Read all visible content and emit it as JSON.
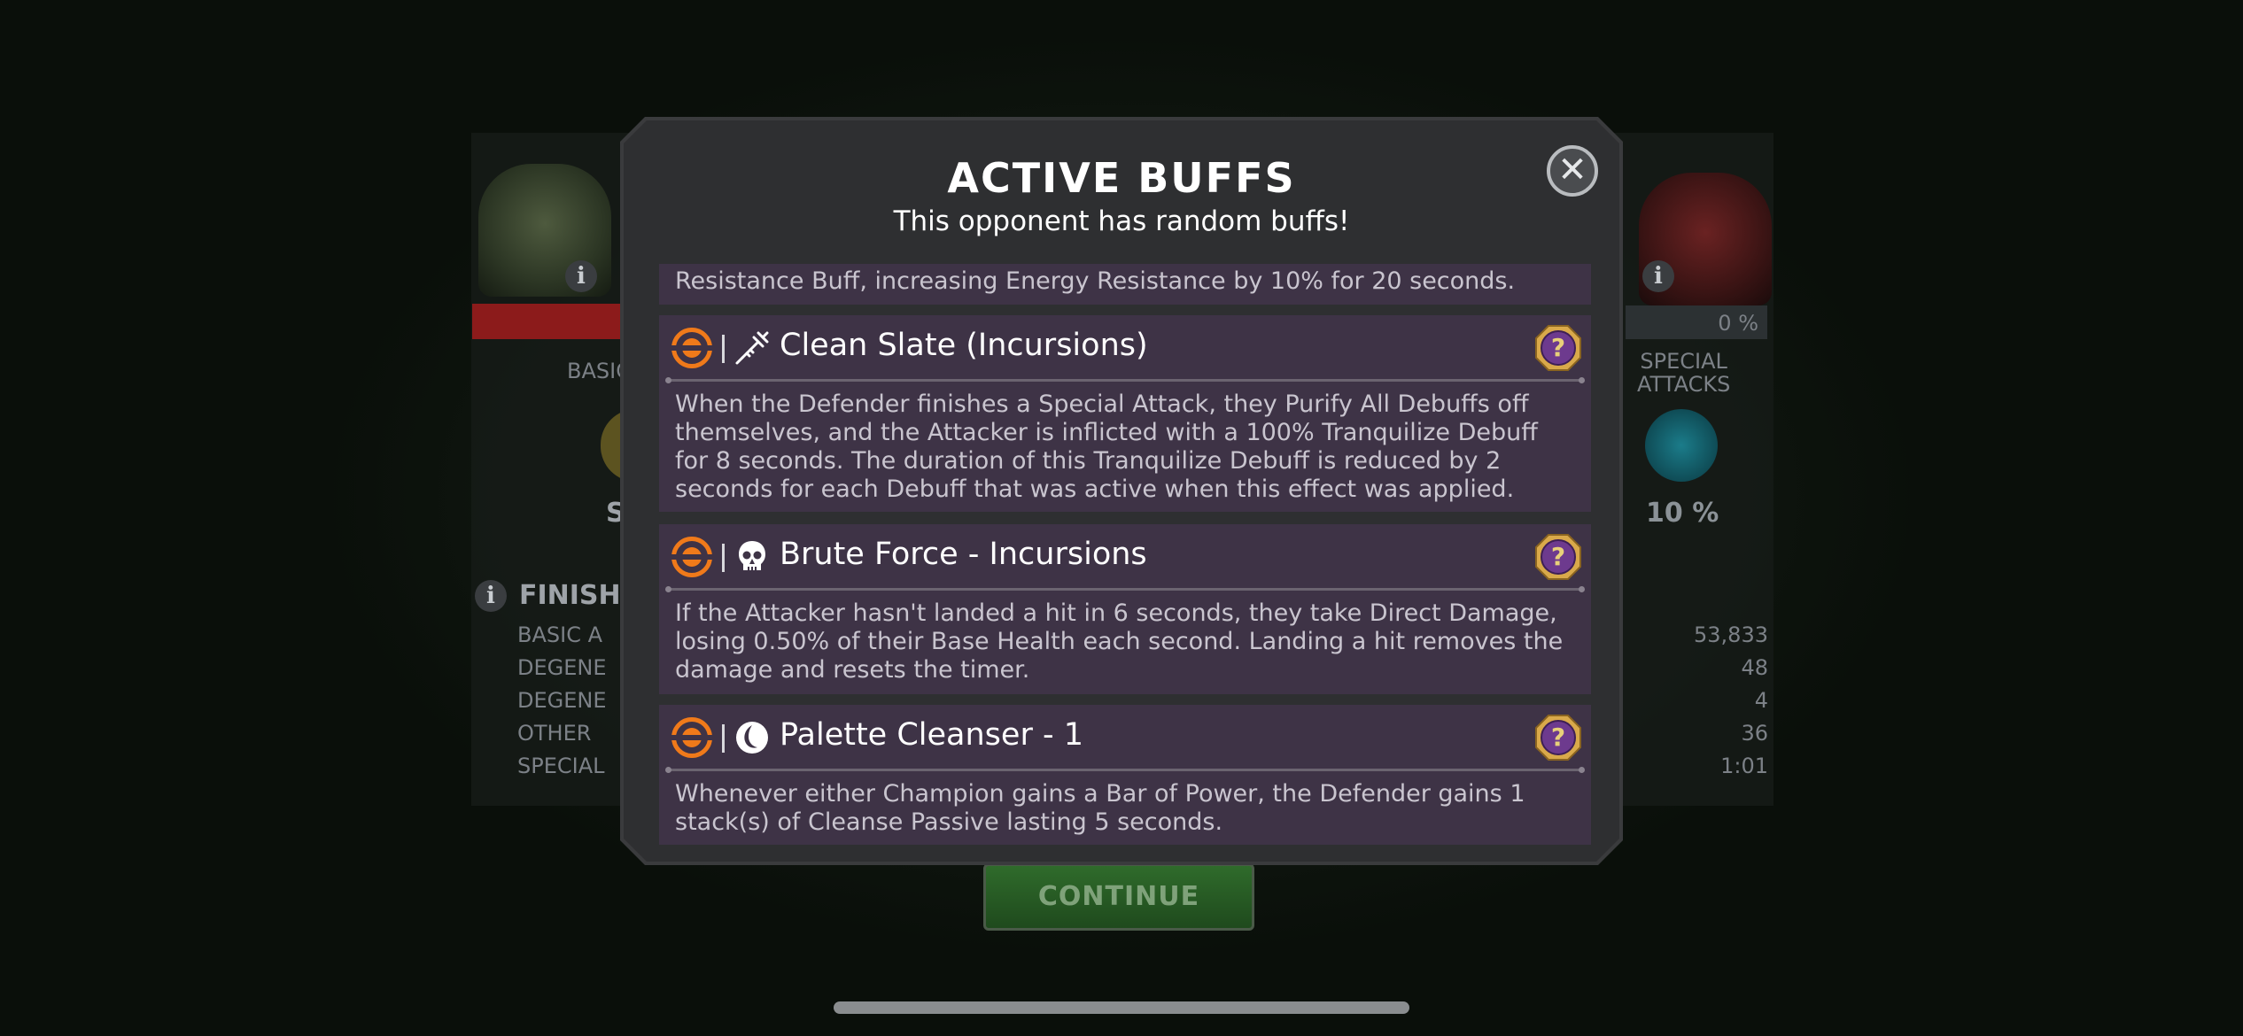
{
  "background": {
    "stats_heading": "FINISH",
    "stats_rows": [
      {
        "label": "BASIC A",
        "value": "53,833"
      },
      {
        "label": "DEGENE",
        "value": "48"
      },
      {
        "label": "DEGENE",
        "value": "4"
      },
      {
        "label": "OTHER",
        "value": "36"
      },
      {
        "label": "SPECIAL",
        "value": "1:01"
      }
    ],
    "left_label": "BASIC",
    "left_value": "S",
    "right_percent_bar": "0 %",
    "right_label": "SPECIAL\nATTACKS",
    "right_value": "10 %",
    "continue_label": "CONTINUE"
  },
  "modal": {
    "title": "ACTIVE BUFFS",
    "subtitle": "This opponent has random buffs!",
    "partial_text": "Resistance Buff, increasing Energy Resistance by 10% for 20 seconds.",
    "buffs": [
      {
        "name": "Clean Slate (Incursions)",
        "icon": "syringe-icon",
        "description": "When the Defender finishes a Special Attack, they Purify All Debuffs off themselves, and the Attacker is inflicted with a 100% Tranquilize Debuff for 8 seconds. The duration of this Tranquilize Debuff is reduced by 2 seconds for each Debuff that was active when this effect was applied."
      },
      {
        "name": "Brute Force - Incursions",
        "icon": "skull-icon",
        "description": "If the Attacker hasn't landed a hit in 6 seconds, they take Direct Damage, losing 0.50% of their Base Health each second. Landing a hit removes the damage and resets the timer."
      },
      {
        "name": "Palette Cleanser - 1",
        "icon": "cleanse-icon",
        "description": "Whenever either Champion gains a Bar of Power, the Defender gains 1 stack(s) of Cleanse Passive lasting 5 seconds."
      }
    ]
  },
  "colors": {
    "card_bg": "#3e3346",
    "slot_orange": "#f07a1a",
    "help_gold": "#d9a94a",
    "help_purple": "#6d3a8e"
  }
}
